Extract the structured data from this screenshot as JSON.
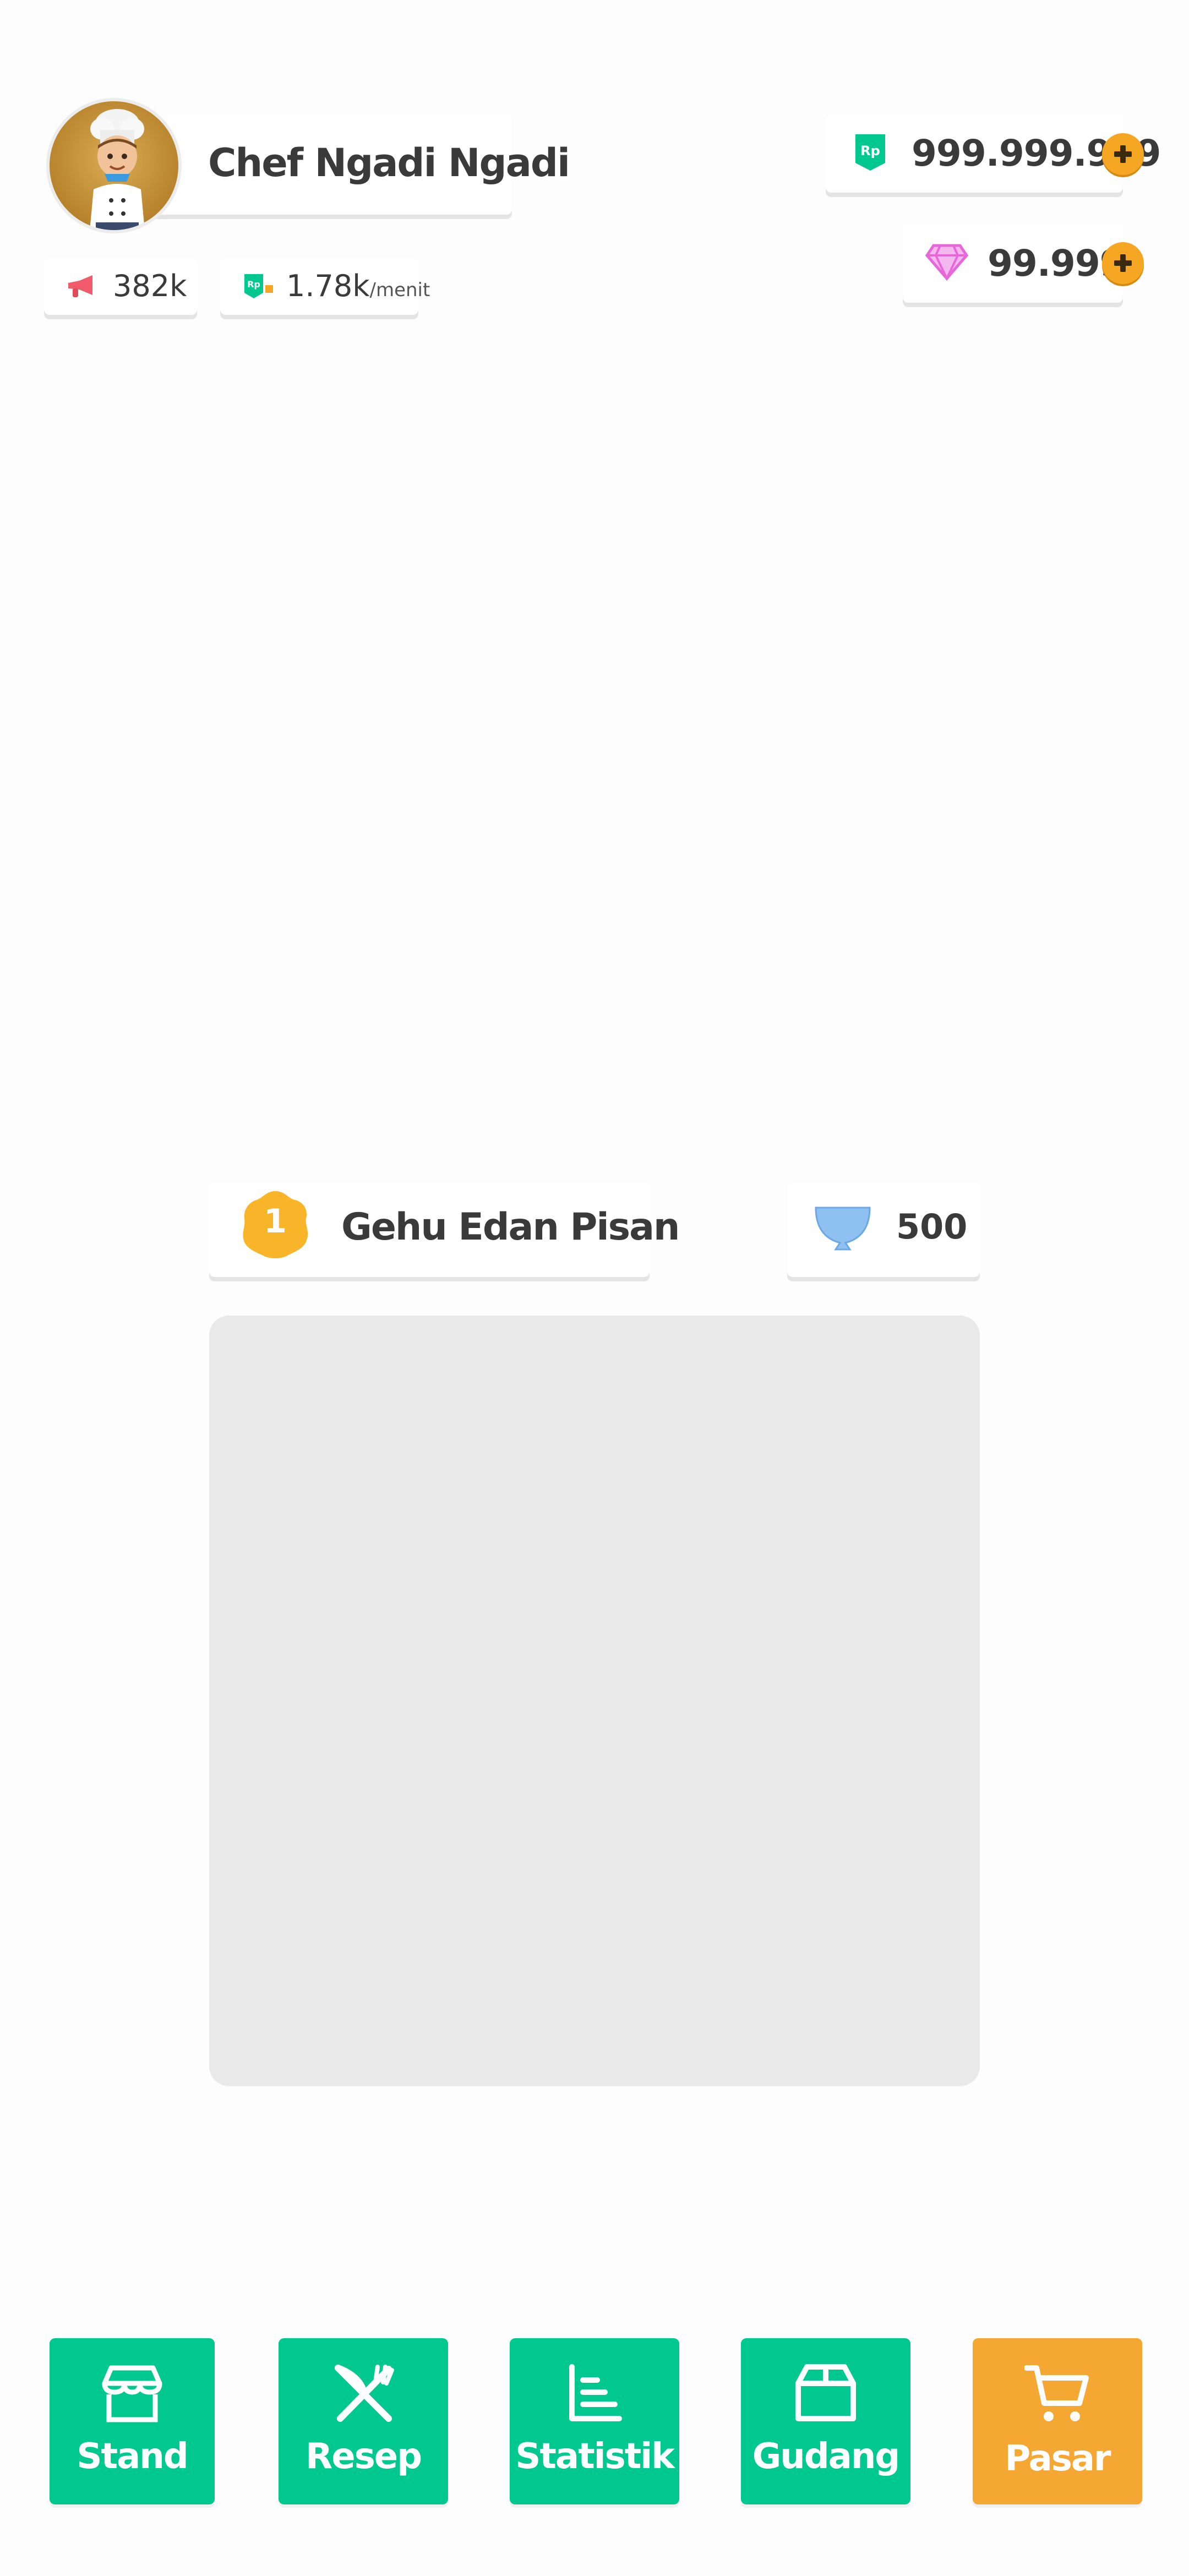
{
  "player": {
    "name": "Chef Ngadi Ngadi",
    "avatar_icon": "chef-avatar"
  },
  "stats": {
    "followers": "382k",
    "income_rate": "1.78k",
    "income_unit": "/menit"
  },
  "currency": {
    "money": "999.999.999",
    "gems": "99.999"
  },
  "dish": {
    "level": "1",
    "name": "Gehu Edan Pisan",
    "bowl_count": "500"
  },
  "nav": {
    "stand": "Stand",
    "resep": "Resep",
    "statistik": "Statistik",
    "gudang": "Gudang",
    "pasar": "Pasar"
  },
  "colors": {
    "primary_green": "#00c88f",
    "accent_orange": "#f5a733",
    "badge_yellow": "#f8b52a",
    "bowl_blue": "#8fc0f2",
    "gem_pink": "#e766d8",
    "megaphone_red": "#f05a6a"
  }
}
